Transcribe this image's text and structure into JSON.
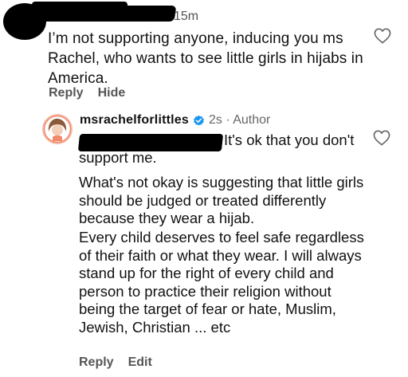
{
  "top_comment": {
    "time": "15m",
    "text": "I’m not supporting anyone, inducing you ms Rachel, who wants to see little girls in hijabs in America.",
    "actions": [
      "Reply",
      "Hide"
    ]
  },
  "reply": {
    "username": "msrachelforlittles",
    "meta": "2s · Author",
    "first_line": "It's ok that you don't support me.",
    "paragraphs": [
      "What's not okay is suggesting that little girls should be judged or treated differently because they wear a hijab.",
      "Every child deserves to feel safe regardless of their faith or what they wear. I will always stand up for the right of every child and person to practice their religion without being the target of fear or hate, Muslim, Jewish, Christian ... etc"
    ],
    "actions": [
      "Reply",
      "Edit"
    ]
  },
  "icons": {
    "like": "heart-outline-icon",
    "verified": "verified-badge-icon"
  },
  "colors": {
    "verified": "#1c96f0",
    "secondary_text": "#555555"
  }
}
